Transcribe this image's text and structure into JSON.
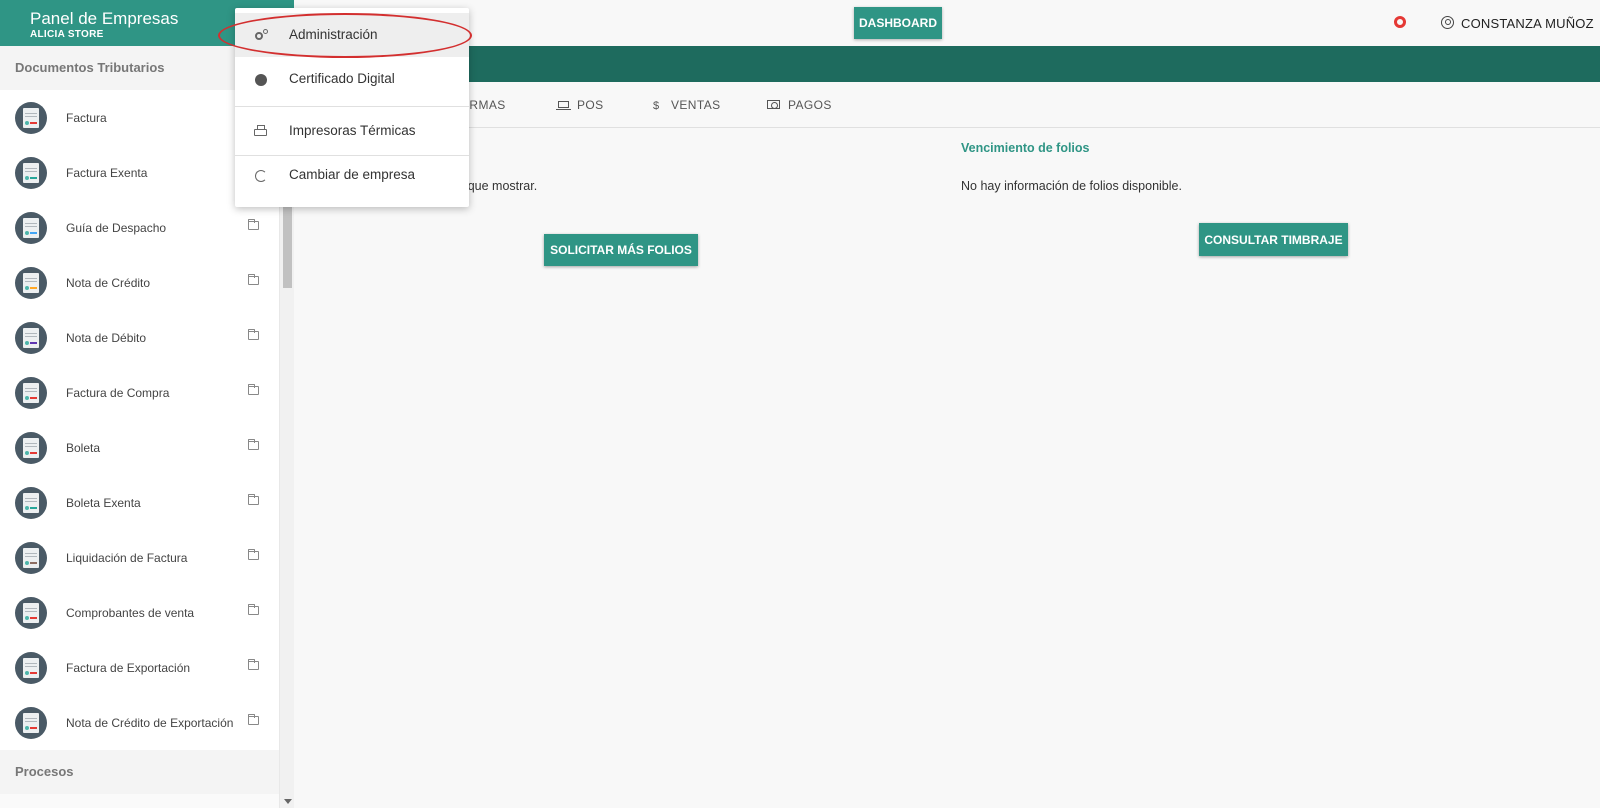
{
  "brand": {
    "title": "Panel de Empresas",
    "company": "ALICIA STORE",
    "color": "#2f9585"
  },
  "topbar": {
    "dashboard_label": "DASHBOARD",
    "user_name": "CONSTANZA MUÑOZ"
  },
  "sidebar": {
    "section_documents": "Documentos Tributarios",
    "section_processes": "Procesos",
    "items": [
      {
        "label": "Factura",
        "accent": "#e53935"
      },
      {
        "label": "Factura Exenta",
        "accent": "#26a69a"
      },
      {
        "label": "Guía de Despacho",
        "accent": "#42a5f5"
      },
      {
        "label": "Nota de Crédito",
        "accent": "#ffa726"
      },
      {
        "label": "Nota de Débito",
        "accent": "#5e35b1"
      },
      {
        "label": "Factura de Compra",
        "accent": "#e53935"
      },
      {
        "label": "Boleta",
        "accent": "#e53935"
      },
      {
        "label": "Boleta Exenta",
        "accent": "#26a69a"
      },
      {
        "label": "Liquidación de Factura",
        "accent": "#8d6e63"
      },
      {
        "label": "Comprobantes de venta",
        "accent": "#e53935"
      },
      {
        "label": "Factura de Exportación",
        "accent": "#e53935"
      },
      {
        "label": "Nota de Crédito de Exportación",
        "accent": "#e53935"
      }
    ]
  },
  "tabs": {
    "mermas": "ERMAS",
    "pos": "POS",
    "ventas": "VENTAS",
    "pagos": "PAGOS",
    "dollar": "$"
  },
  "main": {
    "left_text": "s que mostrar.",
    "solicitar_label": "SOLICITAR MÁS FOLIOS",
    "venc_title": "Vencimiento de folios",
    "venc_text": "No hay información de folios disponible.",
    "consultar_label": "CONSULTAR TIMBRAJE"
  },
  "dropdown": {
    "administracion": "Administración",
    "certificado": "Certificado Digital",
    "impresoras": "Impresoras Térmicas",
    "cambiar": "Cambiar de empresa"
  }
}
